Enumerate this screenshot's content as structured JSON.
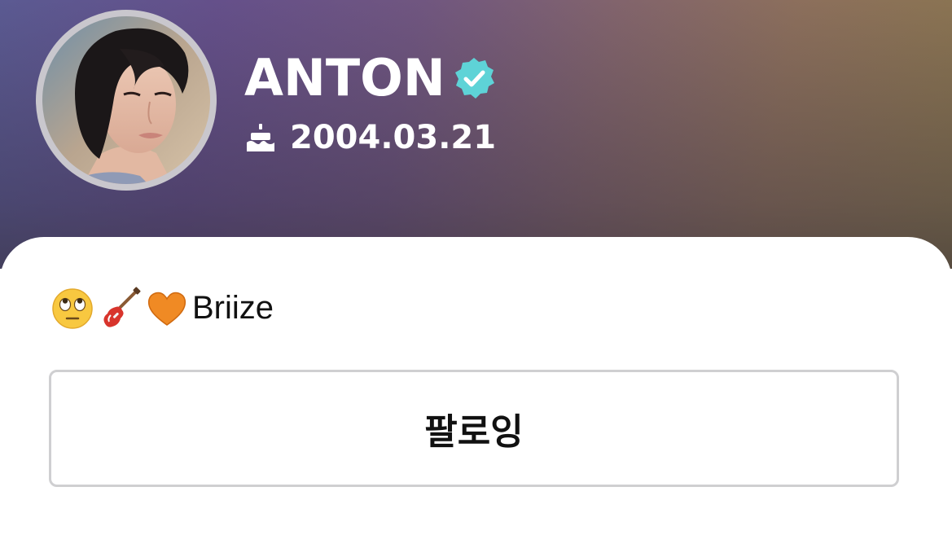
{
  "profile": {
    "name": "ANTON",
    "birthday": "2004.03.21",
    "bio_text": "Briize",
    "bio_emojis": [
      "face-with-rolling-eyes-icon",
      "guitar-icon",
      "orange-heart-icon"
    ],
    "avatar": "profile-photo",
    "verified_icon": "verified-badge-icon",
    "birthday_icon": "cake-icon"
  },
  "actions": {
    "follow_label": "팔로잉"
  },
  "colors": {
    "verified_badge": "#5ed3d7",
    "header_gradient_start": "#5b5a92",
    "header_gradient_end": "#8a7550",
    "button_border": "#cfcfd1"
  }
}
